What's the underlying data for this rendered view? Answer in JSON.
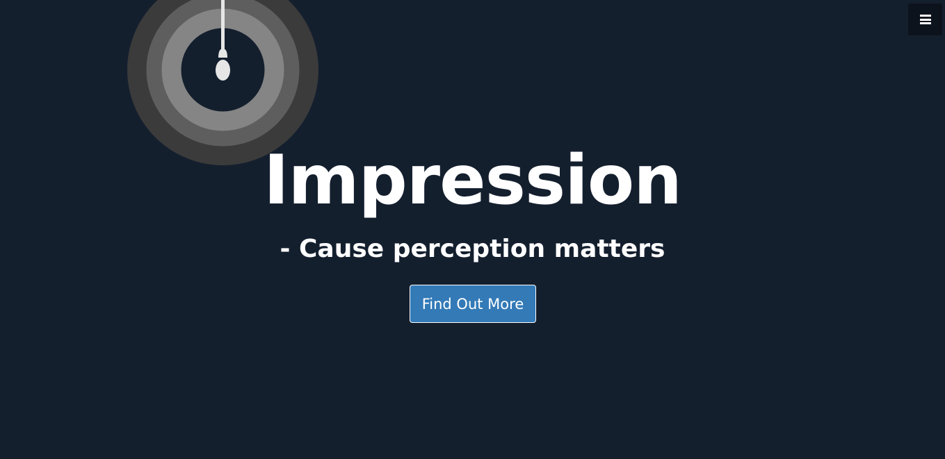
{
  "hero": {
    "title": "Impression",
    "subtitle": "- Cause perception matters",
    "cta_label": "Find Out More"
  },
  "nav": {
    "menu_icon": "hamburger-menu-icon"
  },
  "decor": {
    "logo_icon": "hanging-bulb-icon"
  },
  "colors": {
    "background": "#141f2e",
    "button": "#337ab7",
    "menu_button": "#0d131c",
    "ring_outer": "#3b3b3b",
    "ring_middle": "#5e5e5e",
    "ring_inner": "#858585",
    "bulb": "#e6e6e6"
  }
}
